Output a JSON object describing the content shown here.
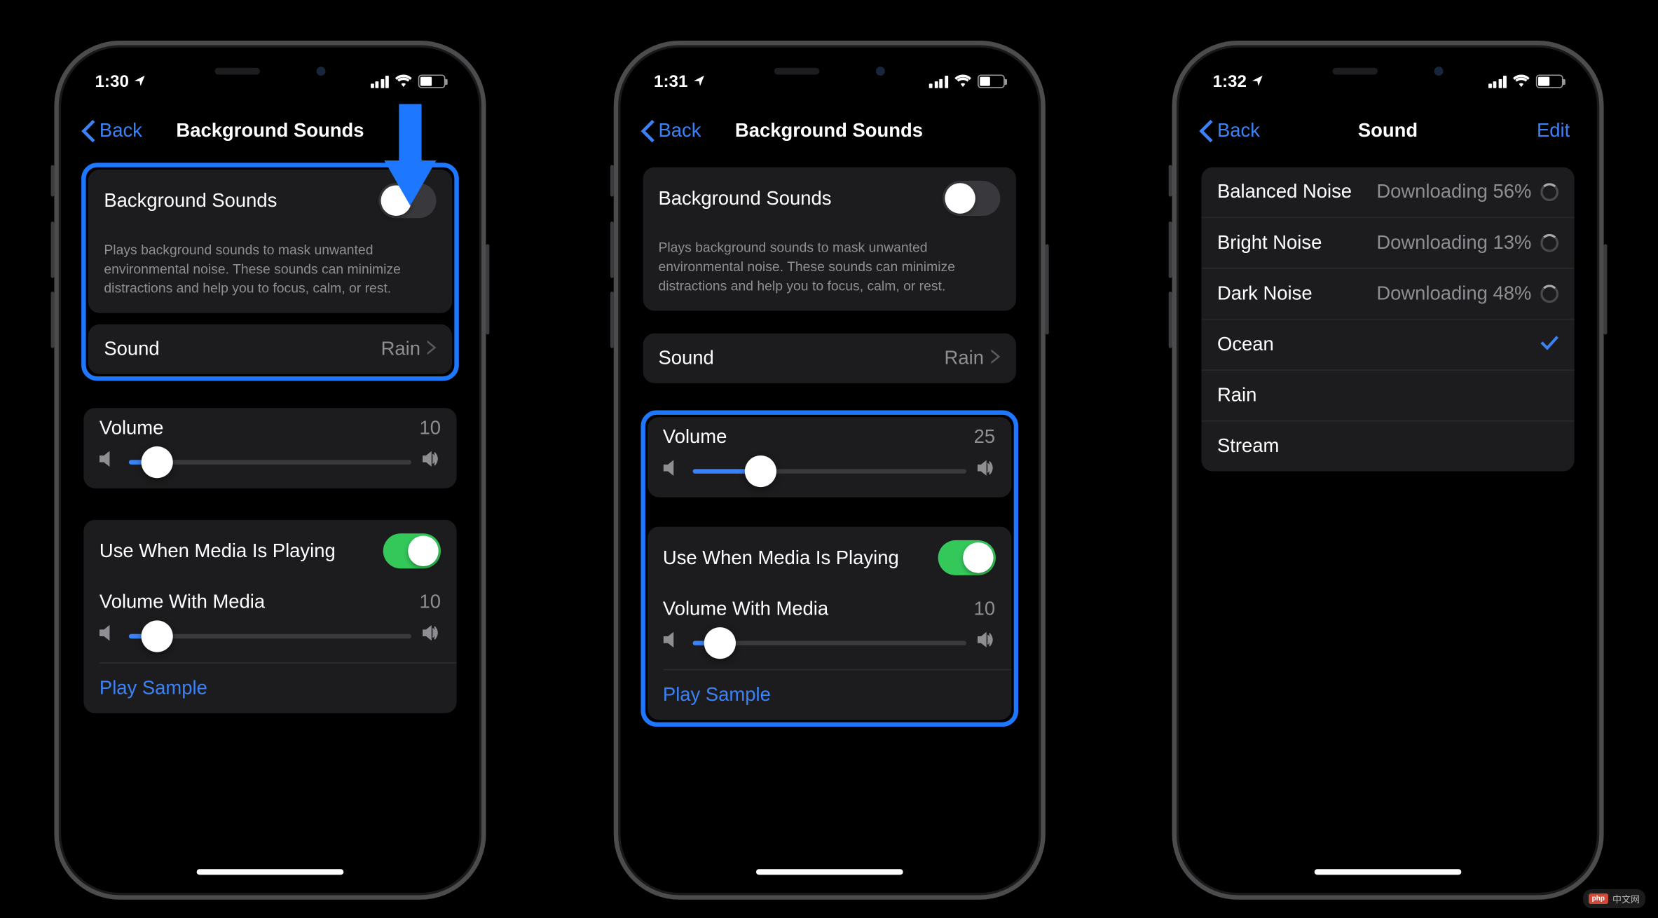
{
  "phones": [
    {
      "status": {
        "time": "1:30",
        "battery_pct": 45
      },
      "nav": {
        "back": "Back",
        "title": "Background Sounds"
      },
      "bg_sounds": {
        "label": "Background Sounds",
        "enabled": false,
        "description": "Plays background sounds to mask unwanted environmental noise. These sounds can minimize distractions and help you to focus, calm, or rest."
      },
      "sound_row": {
        "label": "Sound",
        "value": "Rain"
      },
      "volume": {
        "label": "Volume",
        "value": 10,
        "pct": 10
      },
      "media": {
        "use_label": "Use When Media Is Playing",
        "use_enabled": true,
        "vol_label": "Volume With Media",
        "vol_value": 10,
        "vol_pct": 10,
        "play_sample": "Play Sample"
      },
      "highlights": {
        "top_group": true,
        "media_group": false
      }
    },
    {
      "status": {
        "time": "1:31",
        "battery_pct": 45
      },
      "nav": {
        "back": "Back",
        "title": "Background Sounds"
      },
      "bg_sounds": {
        "label": "Background Sounds",
        "enabled": false,
        "description": "Plays background sounds to mask unwanted environmental noise. These sounds can minimize distractions and help you to focus, calm, or rest."
      },
      "sound_row": {
        "label": "Sound",
        "value": "Rain"
      },
      "volume": {
        "label": "Volume",
        "value": 25,
        "pct": 25
      },
      "media": {
        "use_label": "Use When Media Is Playing",
        "use_enabled": true,
        "vol_label": "Volume With Media",
        "vol_value": 10,
        "vol_pct": 10,
        "play_sample": "Play Sample"
      },
      "highlights": {
        "top_group": false,
        "media_group": true
      }
    },
    {
      "status": {
        "time": "1:32",
        "battery_pct": 45
      },
      "nav": {
        "back": "Back",
        "title": "Sound",
        "edit": "Edit"
      },
      "sounds": [
        {
          "name": "Balanced Noise",
          "status": "Downloading 56%",
          "downloading": true,
          "selected": false
        },
        {
          "name": "Bright Noise",
          "status": "Downloading 13%",
          "downloading": true,
          "selected": false
        },
        {
          "name": "Dark Noise",
          "status": "Downloading 48%",
          "downloading": true,
          "selected": false
        },
        {
          "name": "Ocean",
          "status": "",
          "downloading": false,
          "selected": true
        },
        {
          "name": "Rain",
          "status": "",
          "downloading": false,
          "selected": false
        },
        {
          "name": "Stream",
          "status": "",
          "downloading": false,
          "selected": false
        }
      ]
    }
  ],
  "watermark": {
    "badge": "php",
    "text": "中文网"
  }
}
